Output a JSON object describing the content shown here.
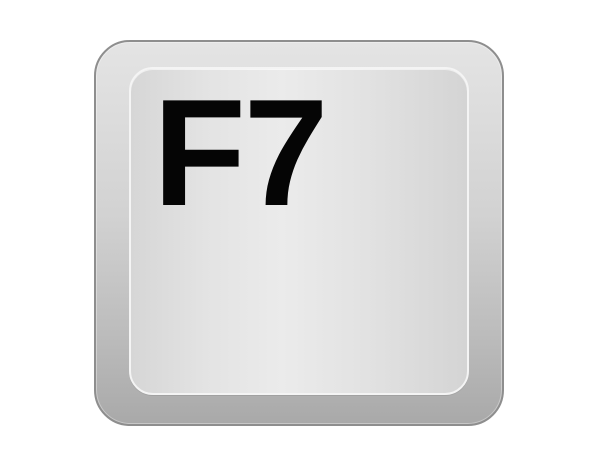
{
  "key": {
    "label": "F7",
    "colors": {
      "label": "#050505",
      "face_light": "#ebebeb",
      "face_dark": "#d4d4d4",
      "body_top": "#e4e4e4",
      "body_bottom": "#a9a9a9",
      "outline": "#8e8e8e",
      "background": "#ffffff"
    }
  }
}
